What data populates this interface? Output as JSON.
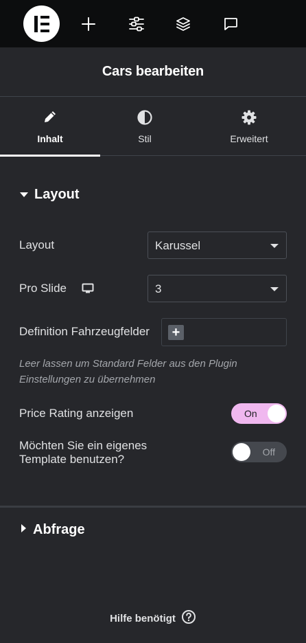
{
  "topbar": {
    "icons": [
      "elementor-logo-icon",
      "plus-icon",
      "settings-sliders-icon",
      "layers-icon",
      "comment-icon"
    ]
  },
  "panel": {
    "title": "Cars bearbeiten"
  },
  "tabs": [
    {
      "label": "Inhalt",
      "icon": "pencil-icon",
      "active": true
    },
    {
      "label": "Stil",
      "icon": "half-circle-icon",
      "active": false
    },
    {
      "label": "Erweitert",
      "icon": "gear-icon",
      "active": false
    }
  ],
  "section_layout": {
    "title": "Layout",
    "expanded": true,
    "controls": {
      "layout": {
        "label": "Layout",
        "value": "Karussel"
      },
      "pro_slide": {
        "label": "Pro Slide",
        "value": "3",
        "device_icon": "desktop-icon"
      },
      "definition": {
        "label": "Definition Fahrzeugfelder",
        "add_label": "+"
      },
      "hint": "Leer lassen um Standard Felder aus den Plugin Einstellungen zu übernehmen",
      "price_rating": {
        "label": "Price Rating anzeigen",
        "state": "On"
      },
      "template": {
        "label_line1": "Möchten Sie ein eigenes",
        "label_line2": "Template benutzen?",
        "state": "Off"
      }
    }
  },
  "section_abfrage": {
    "title": "Abfrage",
    "expanded": false
  },
  "footer": {
    "help_label": "Hilfe benötigt",
    "help_icon": "question-circle-icon"
  },
  "colors": {
    "background": "#26272b",
    "topbar": "#0c0d0e",
    "toggle_on": "#f0b8ef",
    "toggle_off": "#45484e"
  }
}
